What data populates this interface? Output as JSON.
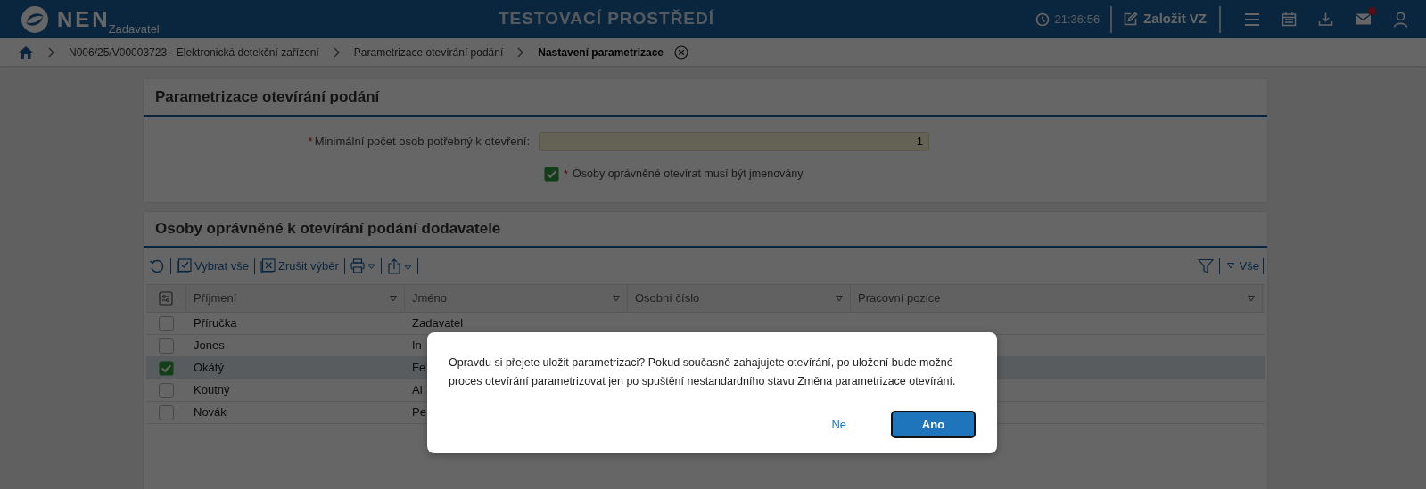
{
  "header": {
    "logo_text": "NEN",
    "logo_subtitle": "Zadavatel",
    "environment": "TESTOVACÍ PROSTŘEDÍ",
    "time": "21:36:56",
    "create_button": "Založit VZ",
    "mail_unread": true
  },
  "breadcrumb": [
    "N006/25/V00003723 - Elektronická detekční zařízení",
    "Parametrizace otevírání podání",
    "Nastavení parametrizace"
  ],
  "settings_panel": {
    "title": "Parametrizace otevírání podání",
    "min_persons": {
      "label": "Minimální počet osob potřebný k otevření:",
      "required_mark": "*",
      "value": "1"
    },
    "named_persons": {
      "label": "Osoby oprávněné otevírat musí být jmenovány",
      "required_mark": "*",
      "checked": true
    }
  },
  "persons_panel": {
    "title": "Osoby oprávněné k otevírání podání dodavatele",
    "toolbar": {
      "select_all": "Vybrat vše",
      "deselect": "Zrušit výběr",
      "filter_label": "Vše"
    },
    "table": {
      "columns": [
        "Příjmení",
        "Jméno",
        "Osobní číslo",
        "Pracovní pozice"
      ],
      "rows": [
        {
          "surname": "Příručka",
          "name": "Zadavatel",
          "checked": false,
          "selected": false
        },
        {
          "surname": "Jones",
          "name": "In",
          "checked": false,
          "selected": false
        },
        {
          "surname": "Okátý",
          "name": "Fe",
          "checked": true,
          "selected": true
        },
        {
          "surname": "Koutný",
          "name": "Al",
          "checked": false,
          "selected": false
        },
        {
          "surname": "Novák",
          "name": "Pe",
          "checked": false,
          "selected": false
        }
      ]
    }
  },
  "dialog": {
    "message": "Opravdu si přejete uložit parametrizaci? Pokud současně zahajujete otevírání, po uložení bude možné proces otevírání parametrizovat jen po spuštění nestandardního stavu Změna parametrizace otevírání.",
    "buttons": [
      {
        "label": "Ne",
        "kind": "link"
      },
      {
        "label": "Ano",
        "kind": "primary"
      }
    ]
  }
}
